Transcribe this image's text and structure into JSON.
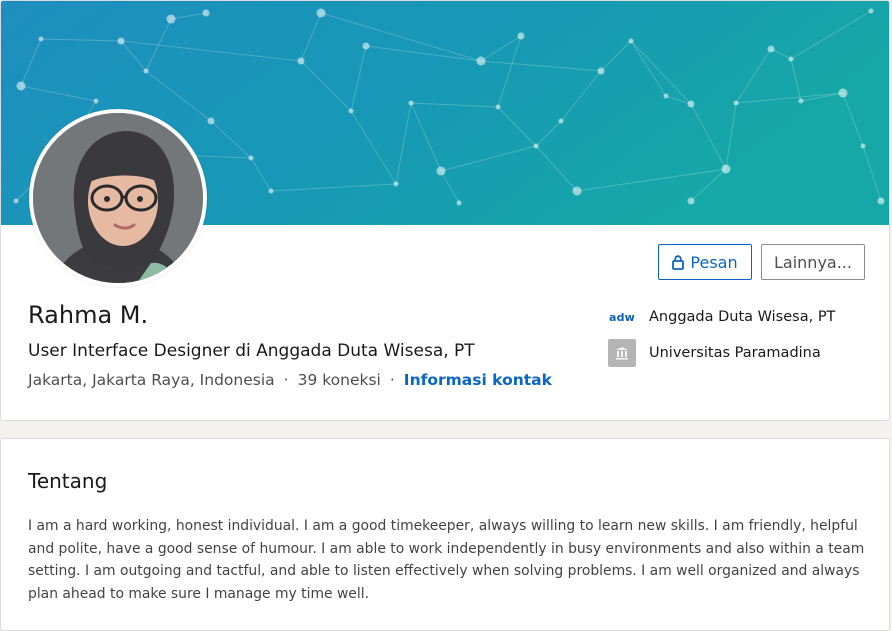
{
  "profile": {
    "name": "Rahma M.",
    "headline": "User Interface Designer di Anggada Duta Wisesa, PT",
    "location": "Jakarta, Jakarta Raya, Indonesia",
    "separator": "·",
    "connections": "39 koneksi",
    "contact_info_link": "Informasi kontak",
    "message_button": "Pesan",
    "more_button": "Lainnya...",
    "current_company": {
      "logo_text": "adw",
      "name": "Anggada Duta Wisesa, PT"
    },
    "education": {
      "name": "Universitas Paramadina"
    }
  },
  "about": {
    "title": "Tentang",
    "text": "I am a hard working, honest individual. I am a good timekeeper, always willing to learn new skills. I am friendly, helpful and polite, have a good sense of humour. I am able to work independently in busy environments and also within a team setting. I am outgoing and tactful, and able to listen effectively when solving problems. I am well organized and always plan ahead to make sure I manage my time well."
  },
  "icons": {
    "lock": "lock-icon",
    "school": "school-building-icon",
    "company": "company-logo",
    "avatar": "profile-photo",
    "banner": "network-banner-image"
  },
  "colors": {
    "accent": "#0a66c2",
    "banner_start": "#1f8fc0",
    "banner_end": "#14a7a6",
    "card_border": "#dcdcdc",
    "page_background": "#f3f2ef"
  }
}
